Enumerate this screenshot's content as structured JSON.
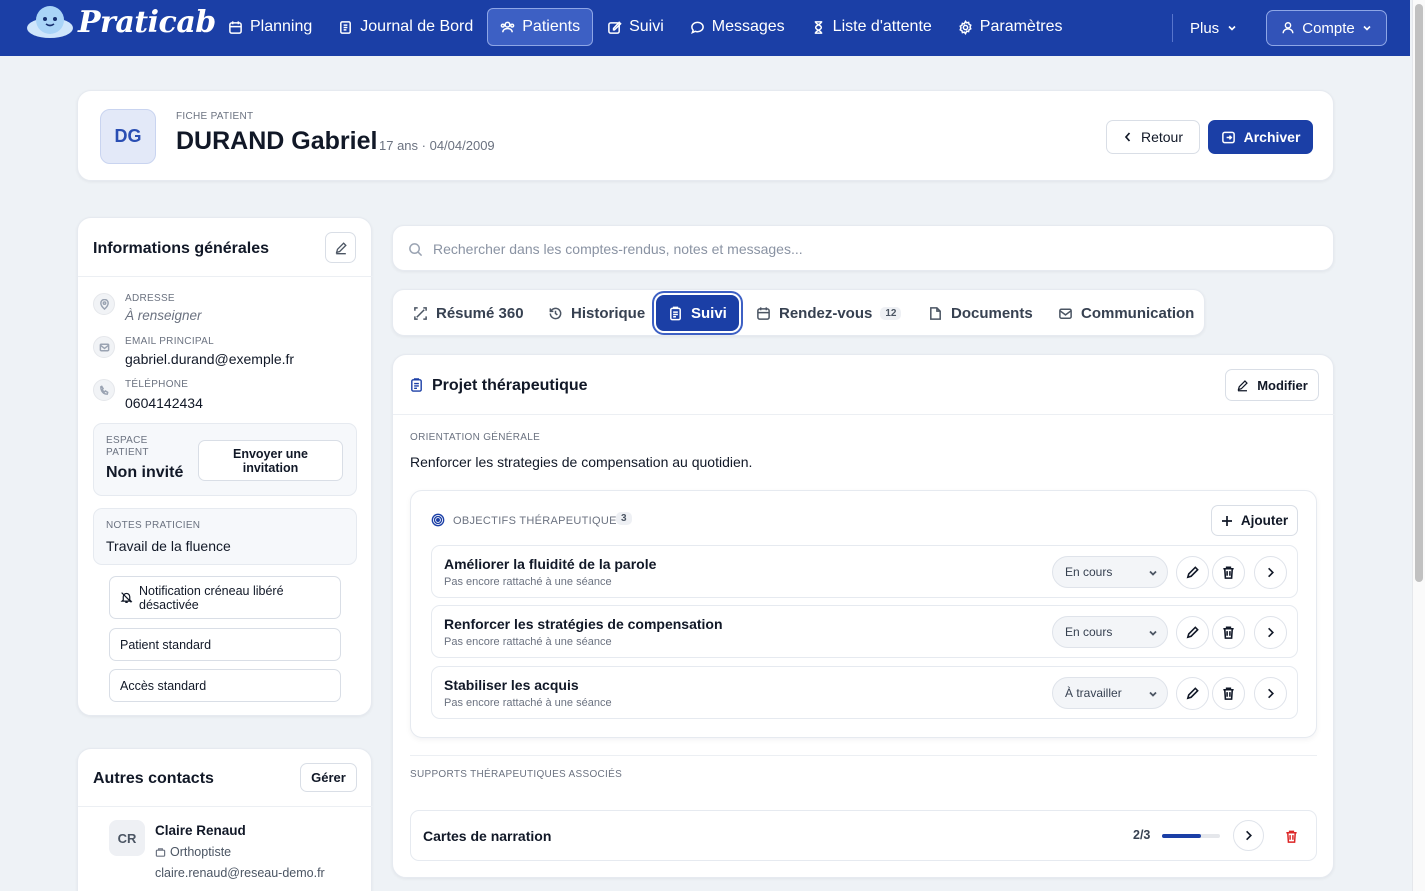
{
  "app": {
    "name": "Praticab"
  },
  "nav": {
    "items": [
      {
        "label": "Planning",
        "icon": "calendar-icon"
      },
      {
        "label": "Journal de Bord",
        "icon": "journal-icon"
      },
      {
        "label": "Patients",
        "icon": "users-icon",
        "active": true
      },
      {
        "label": "Suivi",
        "icon": "edit-icon"
      },
      {
        "label": "Messages",
        "icon": "chat-icon"
      },
      {
        "label": "Liste d'attente",
        "icon": "hourglass-icon"
      },
      {
        "label": "Paramètres",
        "icon": "gear-icon"
      }
    ],
    "more_label": "Plus",
    "account_label": "Compte"
  },
  "patient": {
    "initials": "DG",
    "kicker": "FICHE PATIENT",
    "name": "DURAND Gabriel",
    "meta": "17 ans · 04/04/2009",
    "back_label": "Retour",
    "archive_label": "Archiver"
  },
  "info": {
    "title": "Informations générales",
    "address_label": "ADRESSE",
    "address_value": "À renseigner",
    "email_label": "EMAIL PRINCIPAL",
    "email_value": "gabriel.durand@exemple.fr",
    "phone_label": "TÉLÉPHONE",
    "phone_value": "0604142434",
    "space_label_1": "ESPACE",
    "space_label_2": "PATIENT",
    "space_value": "Non invité",
    "invite_label_1": "Envoyer une",
    "invite_label_2": "invitation",
    "notes_label": "NOTES PRATICIEN",
    "notes_value": "Travail de la fluence",
    "notif_label_1": "Notification créneau libéré",
    "notif_label_2": "désactivée",
    "type_label": "Patient standard",
    "access_label": "Accès standard"
  },
  "contacts": {
    "title": "Autres contacts",
    "manage_label": "Gérer",
    "items": [
      {
        "initials": "CR",
        "name": "Claire Renaud",
        "role": "Orthoptiste",
        "email": "claire.renaud@reseau-demo.fr"
      }
    ]
  },
  "search": {
    "placeholder": "Rechercher dans les comptes-rendus, notes et messages..."
  },
  "tabs": [
    {
      "label": "Résumé 360",
      "icon": "scan-icon"
    },
    {
      "label": "Historique",
      "icon": "history-icon"
    },
    {
      "label": "Suivi",
      "icon": "clipboard-icon",
      "active": true
    },
    {
      "label": "Rendez-vous",
      "icon": "calendar-icon",
      "badge": "12"
    },
    {
      "label": "Documents",
      "icon": "document-icon"
    },
    {
      "label": "Communication",
      "icon": "mail-icon"
    }
  ],
  "project": {
    "title": "Projet thérapeutique",
    "modify_label": "Modifier",
    "orientation_label": "ORIENTATION GÉNÉRALE",
    "orientation_value": "Renforcer les strategies de compensation au quotidien.",
    "objectives_label": "OBJECTIFS THÉRAPEUTIQUES",
    "objectives_count": "3",
    "add_label": "Ajouter",
    "objectives": [
      {
        "title": "Améliorer la fluidité de la parole",
        "subtitle": "Pas encore rattaché à une séance",
        "status": "En cours"
      },
      {
        "title": "Renforcer les stratégies de compensation",
        "subtitle": "Pas encore rattaché à une séance",
        "status": "En cours"
      },
      {
        "title": "Stabiliser les acquis",
        "subtitle": "Pas encore rattaché à une séance",
        "status": "À travailler"
      }
    ],
    "supports_label": "SUPPORTS THÉRAPEUTIQUES ASSOCIÉS",
    "supports": [
      {
        "name": "Cartes de narration",
        "progress_text": "2/3",
        "progress": 0.67
      }
    ]
  },
  "colors": {
    "primary": "#1b3fa6",
    "danger": "#dc2626",
    "background": "#eef2f6"
  }
}
